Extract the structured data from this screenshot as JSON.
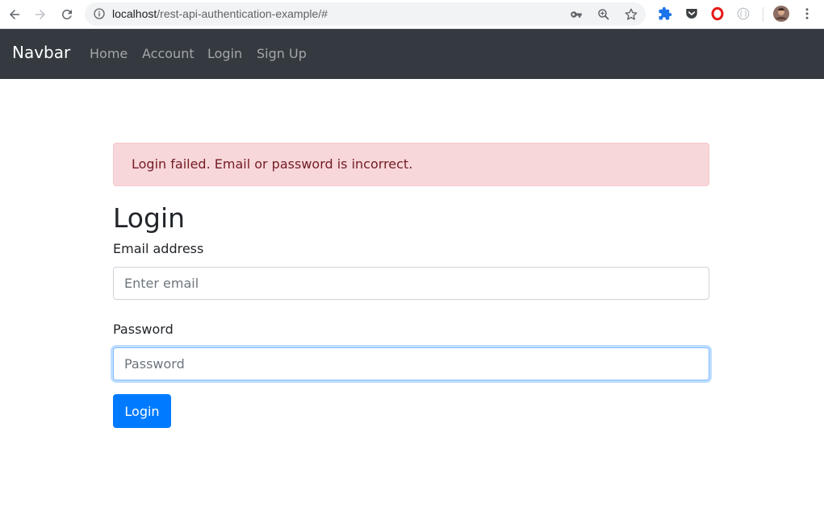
{
  "browser": {
    "url_host": "localhost",
    "url_path": "/rest-api-authentication-example/#"
  },
  "navbar": {
    "brand": "Navbar",
    "links": [
      {
        "label": "Home"
      },
      {
        "label": "Account"
      },
      {
        "label": "Login"
      },
      {
        "label": "Sign Up"
      }
    ]
  },
  "alert": {
    "message": "Login failed. Email or password is incorrect."
  },
  "form": {
    "title": "Login",
    "email": {
      "label": "Email address",
      "placeholder": "Enter email",
      "value": ""
    },
    "password": {
      "label": "Password",
      "placeholder": "Password",
      "value": ""
    },
    "submit_label": "Login"
  },
  "colors": {
    "navbar_bg": "#343a40",
    "alert_bg": "#f8d7da",
    "alert_text": "#721c24",
    "primary": "#007bff"
  },
  "icons": {
    "back": "arrow-left-icon",
    "forward": "arrow-right-icon",
    "reload": "reload-icon",
    "site_info": "info-icon",
    "password_key": "key-icon",
    "zoom": "zoom-icon",
    "bookmark": "star-icon",
    "extensions": [
      "puzzle-icon",
      "pocket-icon",
      "opera-icon",
      "globe-icon"
    ],
    "profile": "avatar",
    "menu": "kebab-menu-icon"
  }
}
